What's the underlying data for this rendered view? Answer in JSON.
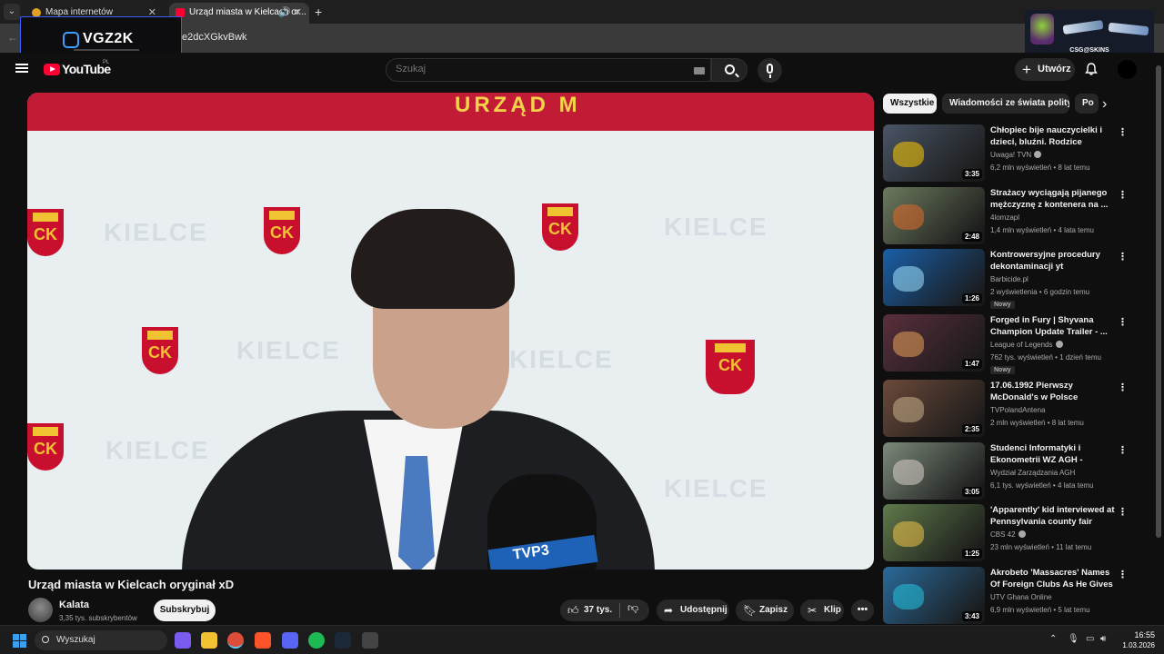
{
  "browser": {
    "tabs": [
      {
        "label": "Mapa internetów",
        "icon": "map-pin-icon"
      },
      {
        "label": "Urząd miasta w Kielcach or...",
        "icon": "youtube-favicon-icon"
      }
    ],
    "url": "e2dcXGkvBwk",
    "overlay_logo": "VGZ2K",
    "ad_text": "CSG@SKINS"
  },
  "yt_header": {
    "logo": "YouTube",
    "country": "PL",
    "search_placeholder": "Szukaj",
    "create_label": "Utwórz"
  },
  "player": {
    "banner_text": "URZĄD M",
    "wall_words": [
      "KIELCE",
      "KIELCE",
      "KIELCE",
      "KIELCE",
      "KIELCE",
      "KIELCE"
    ],
    "crest_text": "CK",
    "mic_text": "TVP3"
  },
  "video": {
    "title": "Urząd miasta w Kielcach oryginał xD",
    "channel": "Kalata",
    "subscribers": "3,35 tys. subskrybentów",
    "subscribe_label": "Subskrybuj",
    "likes": "37 tys.",
    "share_label": "Udostępnij",
    "save_label": "Zapisz",
    "clip_label": "Klip",
    "more_label": "•••"
  },
  "chips": [
    "Wszystkie",
    "Wiadomości ze świata polityki",
    "Po"
  ],
  "recommendations": [
    {
      "title": "Chłopiec bije nauczycielki i dzieci, bluźni. Rodzice uczniów...",
      "channel": "Uwaga! TVN",
      "verified": true,
      "views": "6,2 mln wyświetleń",
      "age": "8 lat temu",
      "duration": "3:35",
      "badge": "",
      "thumb_color": "#4a5566",
      "accent": "#ffcc00"
    },
    {
      "title": "Strażacy wyciągają pijanego mężczyznę z kontenera na ...",
      "channel": "4lomzapl",
      "verified": false,
      "views": "1,4 mln wyświetleń",
      "age": "4 lata temu",
      "duration": "2:48",
      "badge": "",
      "thumb_color": "#6c7a5e",
      "accent": "#e06a2a"
    },
    {
      "title": "Kontrowersyjne procedury dekontaminacji yt",
      "channel": "Barbicide.pl",
      "verified": false,
      "views": "2 wyświetlenia",
      "age": "6 godzin temu",
      "duration": "1:26",
      "badge": "Nowy",
      "thumb_color": "#1a5fa8",
      "accent": "#9fe3ff"
    },
    {
      "title": "Forged in Fury | Shyvana Champion Update Trailer - ...",
      "channel": "League of Legends",
      "verified": true,
      "views": "762 tys. wyświetleń",
      "age": "1 dzień temu",
      "duration": "1:47",
      "badge": "Nowy",
      "thumb_color": "#5a2f3c",
      "accent": "#e8a25a"
    },
    {
      "title": "17.06.1992 Pierwszy McDonald's w Polsce",
      "channel": "TVPolandAntena",
      "verified": false,
      "views": "2 mln wyświetleń",
      "age": "8 lat temu",
      "duration": "2:35",
      "badge": "",
      "thumb_color": "#6b4a3a",
      "accent": "#c9b08a"
    },
    {
      "title": "Studenci Informatyki i Ekonometrii WZ AGH - Reklam...",
      "channel": "Wydział Zarządzania AGH",
      "verified": false,
      "views": "6,1 tys. wyświetleń",
      "age": "4 lata temu",
      "duration": "3:05",
      "badge": "",
      "thumb_color": "#7c8a7a",
      "accent": "#d8d0c8"
    },
    {
      "title": "'Apparently' kid interviewed at Pennsylvania county fair",
      "channel": "CBS 42",
      "verified": true,
      "views": "23 mln wyświetleń",
      "age": "11 lat temu",
      "duration": "1:25",
      "badge": "",
      "thumb_color": "#5f7a4a",
      "accent": "#f2c34a"
    },
    {
      "title": "Akrobeto 'Massacres' Names Of Foreign Clubs As He Gives ...",
      "channel": "UTV Ghana Online",
      "verified": false,
      "views": "6,9 mln wyświetleń",
      "age": "5 lat temu",
      "duration": "3:43",
      "badge": "",
      "thumb_color": "#2a6a9a",
      "accent": "#22c4e0"
    }
  ],
  "taskbar": {
    "search_label": "Wyszukaj",
    "time": "16:55",
    "date": "1.03.2026",
    "apps": [
      {
        "name": "copilot-icon",
        "color": "#7a5cf0"
      },
      {
        "name": "file-explorer-icon",
        "color": "#f2c233"
      },
      {
        "name": "chrome-icon",
        "color": "#dd4b39"
      },
      {
        "name": "brave-icon",
        "color": "#fb542b"
      },
      {
        "name": "discord-icon",
        "color": "#5865f2"
      },
      {
        "name": "spotify-icon",
        "color": "#1db954"
      },
      {
        "name": "steam-icon",
        "color": "#1b2838"
      },
      {
        "name": "unknown-app-icon",
        "color": "#444444"
      }
    ]
  },
  "colors": {
    "bg": "#0f0f0f",
    "accent_red": "#ff0033",
    "chip_active": "#f1f1f1"
  }
}
